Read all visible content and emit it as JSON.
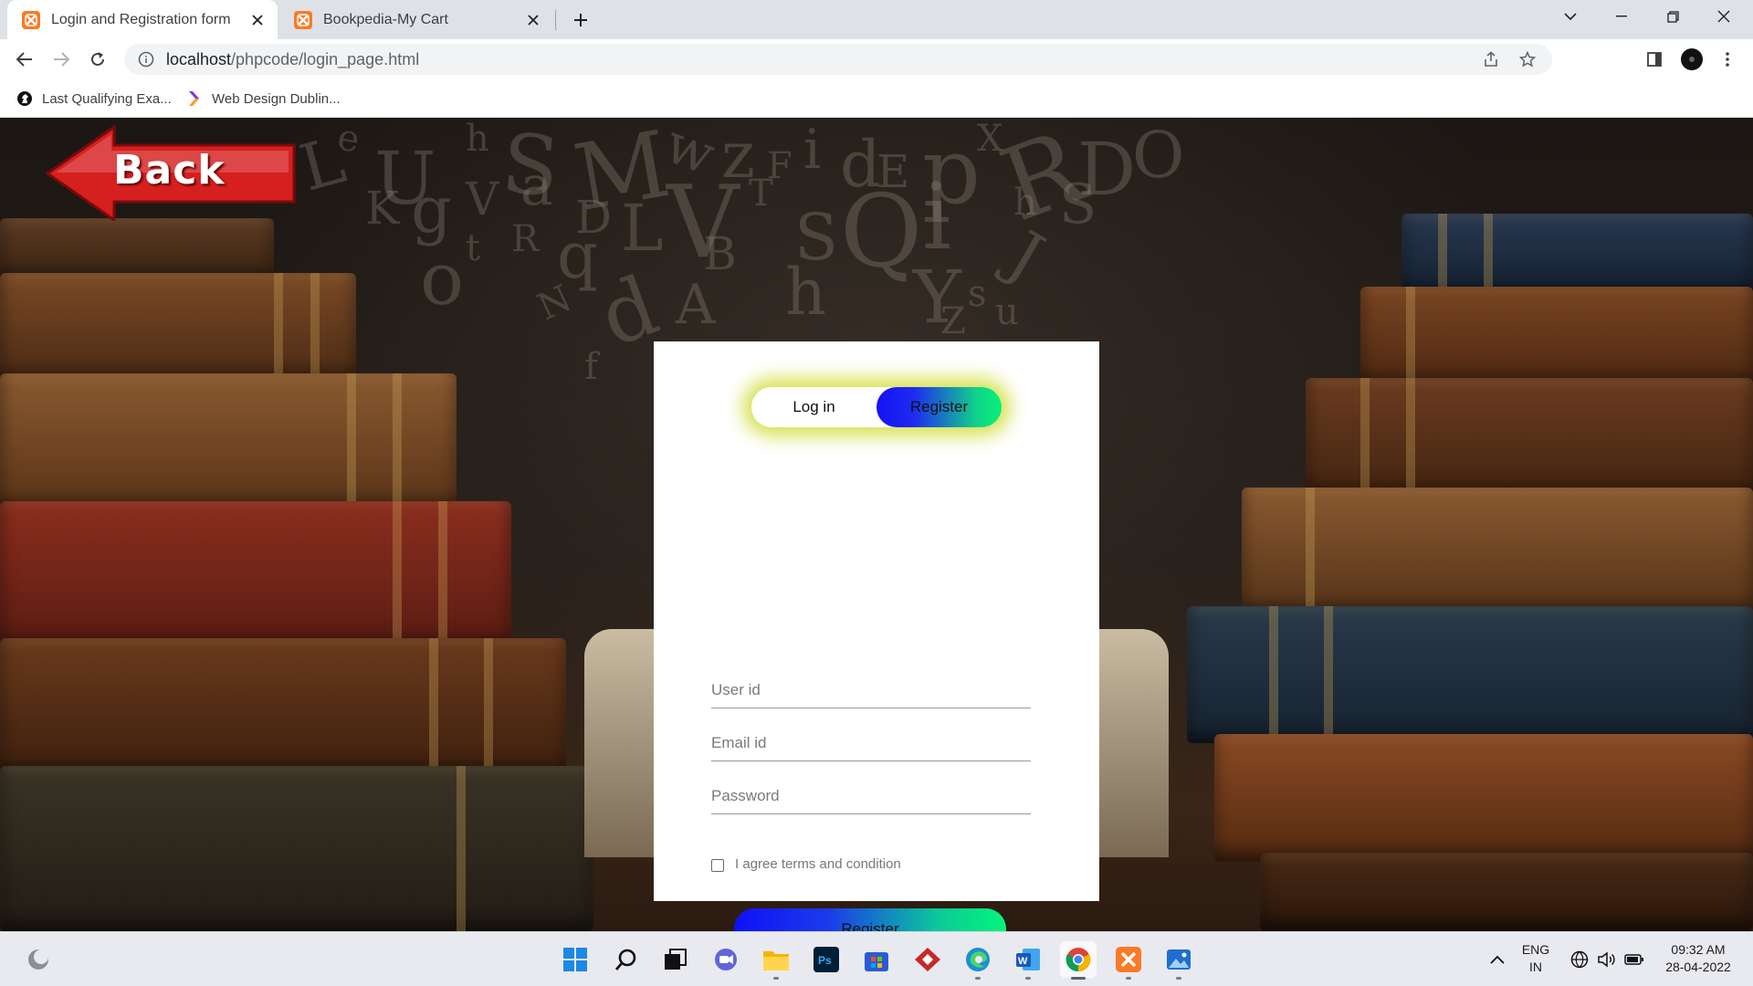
{
  "browser": {
    "tabs": [
      {
        "title": "Login and Registration form",
        "active": true
      },
      {
        "title": "Bookpedia-My Cart",
        "active": false
      }
    ],
    "url_host": "localhost",
    "url_path": "/phpcode/login_page.html",
    "bookmarks": [
      {
        "label": "Last Qualifying Exa...",
        "icon": "chess-knight-icon"
      },
      {
        "label": "Web Design Dublin...",
        "icon": "colorful-chevron-icon"
      }
    ]
  },
  "page": {
    "back_label": "Back",
    "switch": {
      "login_label": "Log in",
      "register_label": "Register",
      "selected": "Register"
    },
    "form": {
      "user_placeholder": "User id",
      "email_placeholder": "Email id",
      "password_placeholder": "Password",
      "agree_label": "I agree terms and condition",
      "submit_label": "Register"
    },
    "background_letters": [
      "L",
      "e",
      "U",
      "h",
      "S",
      "M",
      "w",
      "z",
      "F",
      "i",
      "d",
      "E",
      "p",
      "X",
      "R",
      "D",
      "O",
      "K",
      "g",
      "V",
      "a",
      "D",
      "L",
      "V",
      "T",
      "S",
      "Q",
      "i",
      "h",
      "S",
      "o",
      "t",
      "R",
      "q",
      "B",
      "d",
      "A",
      "h",
      "Y",
      "s",
      "J",
      "N",
      "Z",
      "u",
      "f",
      "M",
      "L",
      "b"
    ]
  },
  "taskbar": {
    "apps": [
      "start-icon",
      "search-icon",
      "task-view-icon",
      "chat-icon",
      "file-explorer-icon",
      "photoshop-icon",
      "store-icon",
      "app-red-icon",
      "edge-icon",
      "word-icon",
      "chrome-icon",
      "xampp-icon",
      "photos-icon"
    ],
    "language_line1": "ENG",
    "language_line2": "IN",
    "time": "09:32 AM",
    "date": "28-04-2022"
  },
  "colors": {
    "accent_blue": "#1414f5",
    "accent_green": "#08f07a",
    "glow_yellow": "#ceda28",
    "back_red": "#d61f1f"
  }
}
